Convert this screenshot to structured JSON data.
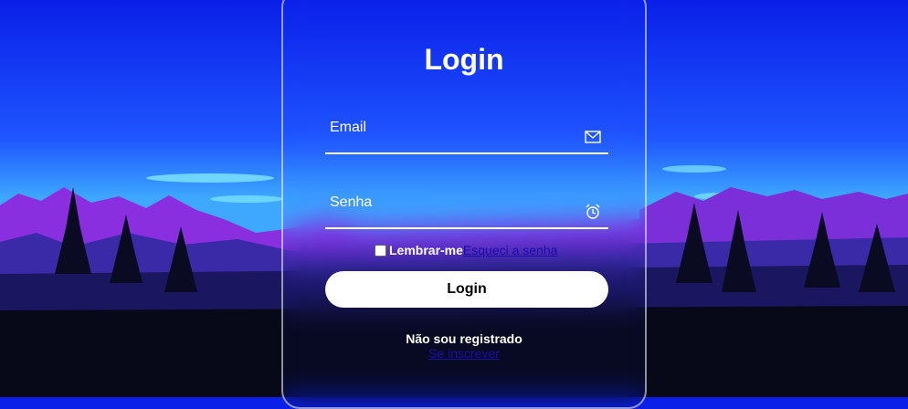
{
  "login": {
    "title": "Login",
    "email_placeholder": "Email",
    "password_placeholder": "Senha",
    "remember_label": "Lembrar-me",
    "forgot_link": "Esqueci a senha",
    "submit_label": "Login",
    "not_registered_text": "Não sou registrado",
    "signup_link": "Se inscrever"
  },
  "icons": {
    "email": "mail-icon",
    "password": "alarm-clock-icon"
  },
  "colors": {
    "sky_top": "#0a1fe8",
    "mountains": "#9a2fe0",
    "link": "#1a0dab",
    "button_bg": "#ffffff"
  }
}
